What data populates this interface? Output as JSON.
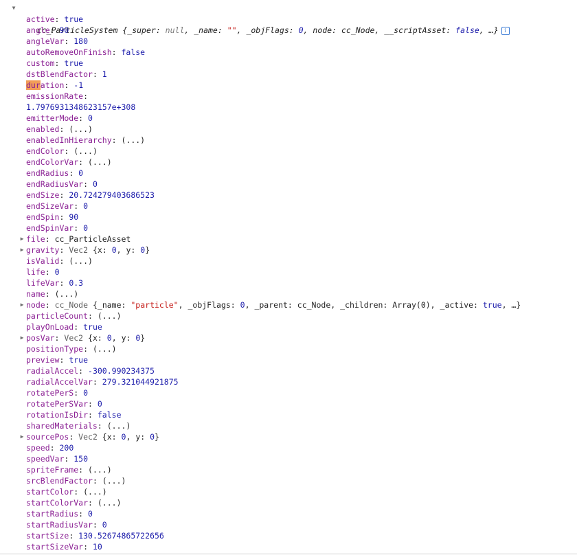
{
  "header": {
    "arrow": "▼",
    "name": "cc_ParticleSystem",
    "open": " {",
    "super_key": "_super",
    "super_val": "null",
    "name_key": "_name",
    "name_val": "\"\"",
    "flags_key": "_objFlags",
    "flags_val": "0",
    "node_key": "node",
    "node_val": "cc_Node",
    "script_key": "__scriptAsset",
    "script_val": "false",
    "ellipsis": "…}",
    "info_icon": "i"
  },
  "props": {
    "active": {
      "key": "active",
      "val": "true"
    },
    "angle": {
      "key": "angle",
      "val": "90"
    },
    "angleVar": {
      "key": "angleVar",
      "val": "180"
    },
    "autoRemoveOnFinish": {
      "key": "autoRemoveOnFinish",
      "val": "false"
    },
    "custom": {
      "key": "custom",
      "val": "true"
    },
    "dstBlendFactor": {
      "key": "dstBlendFactor",
      "val": "1"
    },
    "duration": {
      "key_hl": "dur",
      "key_rest": "ation",
      "val": "-1"
    },
    "emissionRate": {
      "key": "emissionRate",
      "val": "1.7976931348623157e+308"
    },
    "emitterMode": {
      "key": "emitterMode",
      "val": "0"
    },
    "enabled": {
      "key": "enabled",
      "val": "(...)"
    },
    "enabledInHierarchy": {
      "key": "enabledInHierarchy",
      "val": "(...)"
    },
    "endColor": {
      "key": "endColor",
      "val": "(...)"
    },
    "endColorVar": {
      "key": "endColorVar",
      "val": "(...)"
    },
    "endRadius": {
      "key": "endRadius",
      "val": "0"
    },
    "endRadiusVar": {
      "key": "endRadiusVar",
      "val": "0"
    },
    "endSize": {
      "key": "endSize",
      "val": "20.724279403686523"
    },
    "endSizeVar": {
      "key": "endSizeVar",
      "val": "0"
    },
    "endSpin": {
      "key": "endSpin",
      "val": "90"
    },
    "endSpinVar": {
      "key": "endSpinVar",
      "val": "0"
    },
    "file": {
      "arrow": "▶",
      "key": "file",
      "val": "cc_ParticleAsset"
    },
    "gravity": {
      "arrow": "▶",
      "key": "gravity",
      "cls": "Vec2",
      "x_key": "x",
      "x_val": "0",
      "y_key": "y",
      "y_val": "0"
    },
    "isValid": {
      "key": "isValid",
      "val": "(...)"
    },
    "life": {
      "key": "life",
      "val": "0"
    },
    "lifeVar": {
      "key": "lifeVar",
      "val": "0.3"
    },
    "name": {
      "key": "name",
      "val": "(...)"
    },
    "node": {
      "arrow": "▶",
      "key": "node",
      "cls": "cc_Node",
      "name_key": "_name",
      "name_val": "\"particle\"",
      "flags_key": "_objFlags",
      "flags_val": "0",
      "parent_key": "_parent",
      "parent_val": "cc_Node",
      "children_key": "_children",
      "children_val": "Array(0)",
      "active_key": "_active",
      "active_val": "true",
      "ellipsis": "…}"
    },
    "particleCount": {
      "key": "particleCount",
      "val": "(...)"
    },
    "playOnLoad": {
      "key": "playOnLoad",
      "val": "true"
    },
    "posVar": {
      "arrow": "▶",
      "key": "posVar",
      "cls": "Vec2",
      "x_key": "x",
      "x_val": "0",
      "y_key": "y",
      "y_val": "0"
    },
    "positionType": {
      "key": "positionType",
      "val": "(...)"
    },
    "preview": {
      "key": "preview",
      "val": "true"
    },
    "radialAccel": {
      "key": "radialAccel",
      "val": "-300.990234375"
    },
    "radialAccelVar": {
      "key": "radialAccelVar",
      "val": "279.321044921875"
    },
    "rotatePerS": {
      "key": "rotatePerS",
      "val": "0"
    },
    "rotatePerSVar": {
      "key": "rotatePerSVar",
      "val": "0"
    },
    "rotationIsDir": {
      "key": "rotationIsDir",
      "val": "false"
    },
    "sharedMaterials": {
      "key": "sharedMaterials",
      "val": "(...)"
    },
    "sourcePos": {
      "arrow": "▶",
      "key": "sourcePos",
      "cls": "Vec2",
      "x_key": "x",
      "x_val": "0",
      "y_key": "y",
      "y_val": "0"
    },
    "speed": {
      "key": "speed",
      "val": "200"
    },
    "speedVar": {
      "key": "speedVar",
      "val": "150"
    },
    "spriteFrame": {
      "key": "spriteFrame",
      "val": "(...)"
    },
    "srcBlendFactor": {
      "key": "srcBlendFactor",
      "val": "(...)"
    },
    "startColor": {
      "key": "startColor",
      "val": "(...)"
    },
    "startColorVar": {
      "key": "startColorVar",
      "val": "(...)"
    },
    "startRadius": {
      "key": "startRadius",
      "val": "0"
    },
    "startRadiusVar": {
      "key": "startRadiusVar",
      "val": "0"
    },
    "startSize": {
      "key": "startSize",
      "val": "130.52674865722656"
    },
    "startSizeVar": {
      "key": "startSizeVar",
      "val": "10"
    }
  },
  "colors": {
    "key": "#8a1f93",
    "number": "#1c1cab",
    "string": "#c41a16",
    "highlight": "#f29d58",
    "info_icon": "#3a7bd5"
  }
}
